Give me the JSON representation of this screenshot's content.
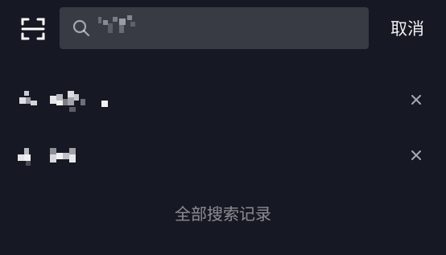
{
  "search": {
    "value": "",
    "placeholder": ""
  },
  "header": {
    "cancel_label": "取消"
  },
  "history": {
    "items": [
      {
        "term": ""
      },
      {
        "term": ""
      }
    ],
    "all_label": "全部搜索记录"
  },
  "icons": {
    "scan": "scan-icon",
    "search": "search-icon",
    "delete": "close-icon"
  },
  "colors": {
    "background": "#161823",
    "search_bg": "#393b44",
    "text_primary": "#f0f0f2",
    "text_secondary": "rgba(255,255,255,0.5)"
  }
}
